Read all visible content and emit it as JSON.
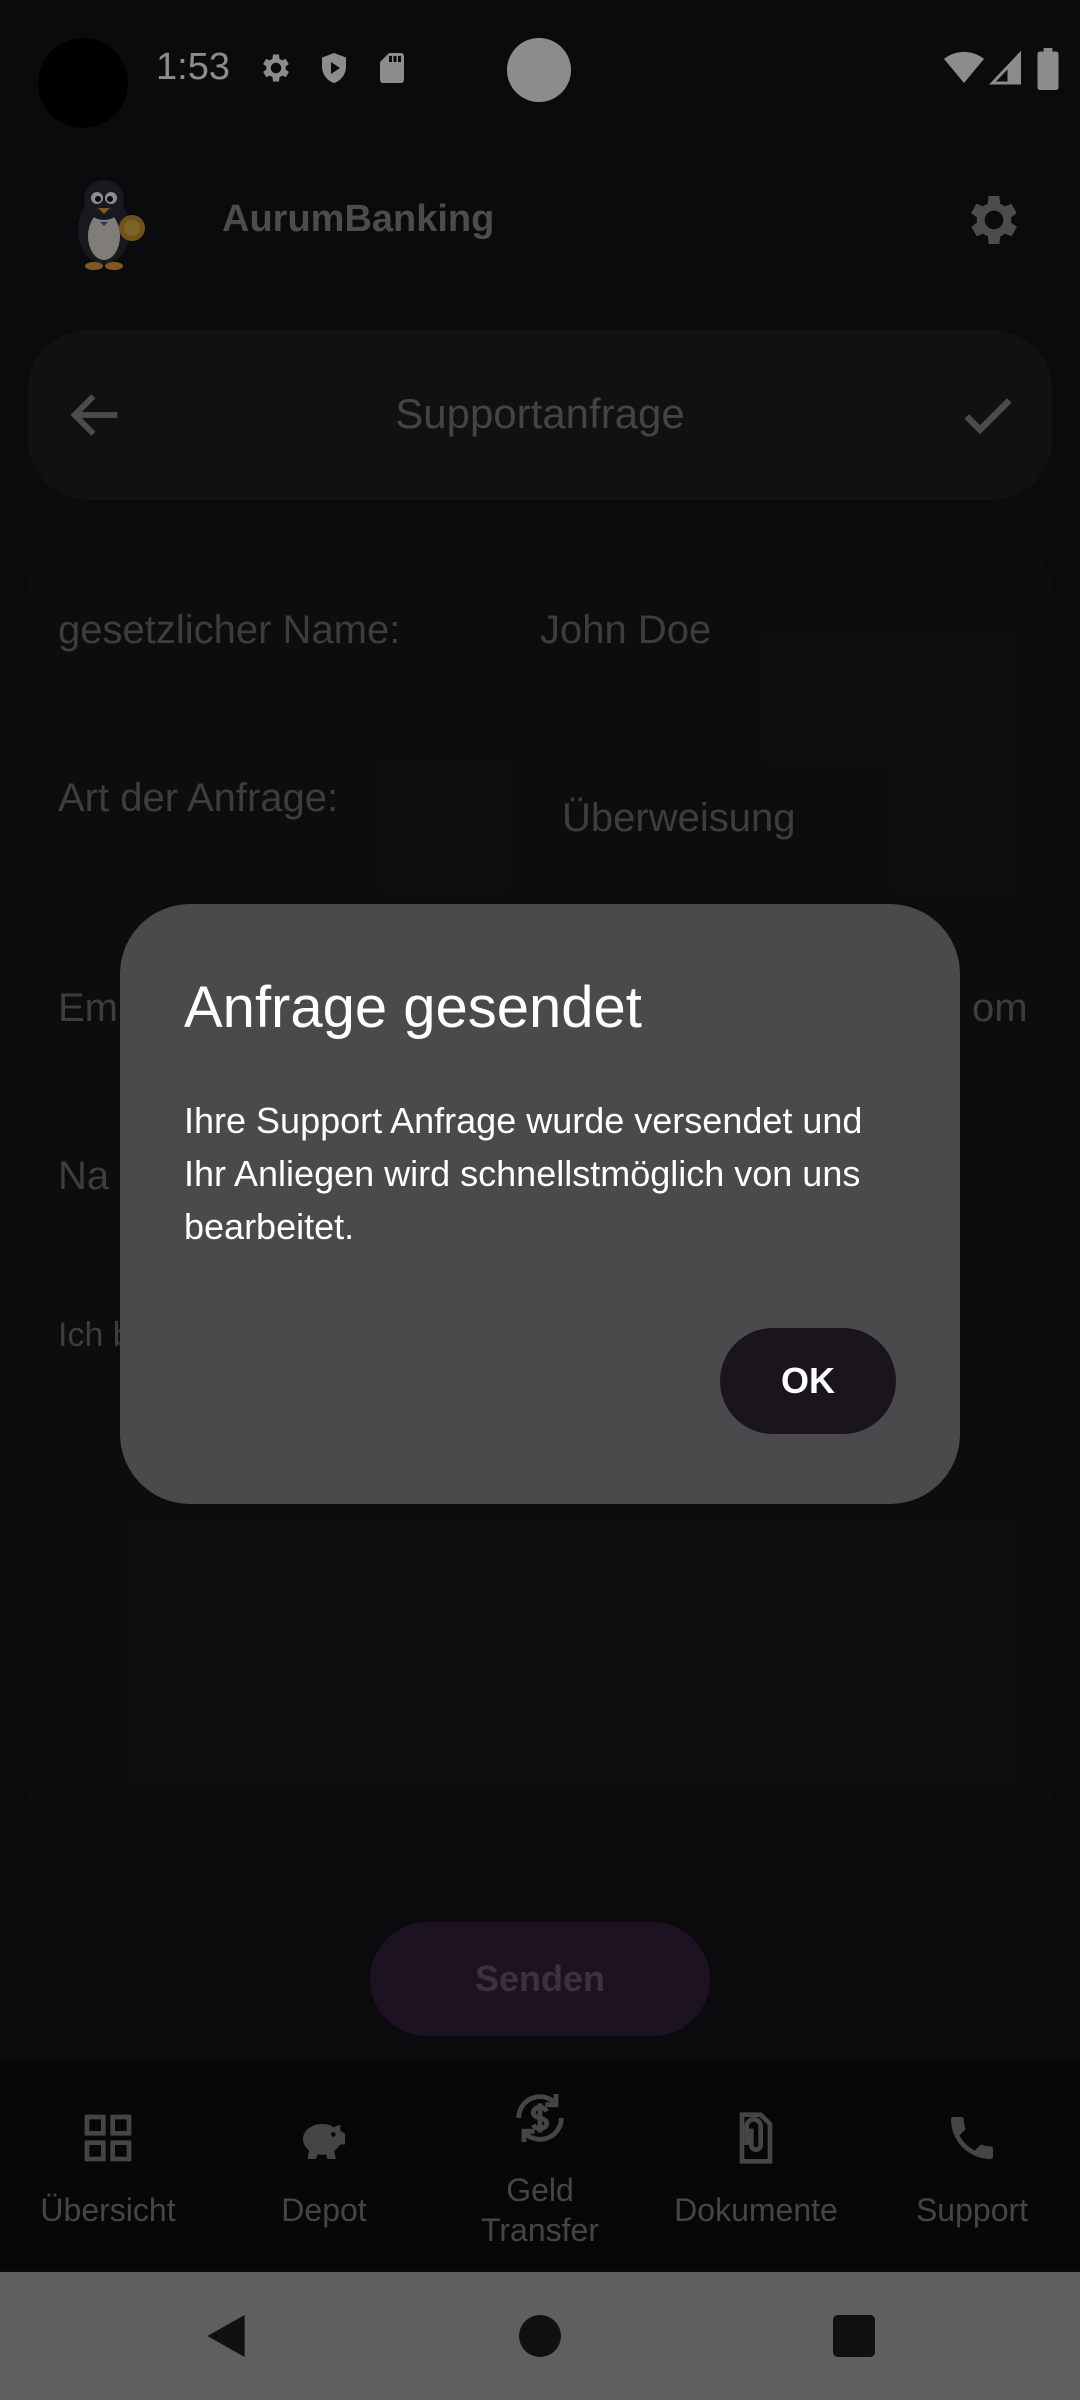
{
  "status_bar": {
    "time": "1:53"
  },
  "app": {
    "title": "AurumBanking",
    "logo_icon": "penguin-coin-logo",
    "settings_icon": "gear-icon"
  },
  "topbar": {
    "title": "Supportanfrage",
    "back_icon": "arrow-left-icon",
    "confirm_icon": "check-icon"
  },
  "form": {
    "name_label": "gesetzlicher Name:",
    "name_value": "John Doe",
    "type_label": "Art der Anfrage:",
    "type_value": "Überweisung",
    "email_label_partial": "Em",
    "email_value_partial": "om",
    "message_label_partial": "Na",
    "consent_partial": "Ich b"
  },
  "send_button": "Senden",
  "bottom_nav": [
    {
      "label": "Übersicht",
      "icon": "grid-icon"
    },
    {
      "label": "Depot",
      "icon": "piggy-bank-icon"
    },
    {
      "label": "Geld\nTransfer",
      "icon": "currency-exchange-icon"
    },
    {
      "label": "Dokumente",
      "icon": "paperclip-document-icon"
    },
    {
      "label": "Support",
      "icon": "phone-icon"
    }
  ],
  "dialog": {
    "title": "Anfrage gesendet",
    "text": "Ihre Support Anfrage wurde versendet und Ihr Anliegen wird schnellstmöglich von uns bearbeitet.",
    "ok_label": "OK"
  }
}
